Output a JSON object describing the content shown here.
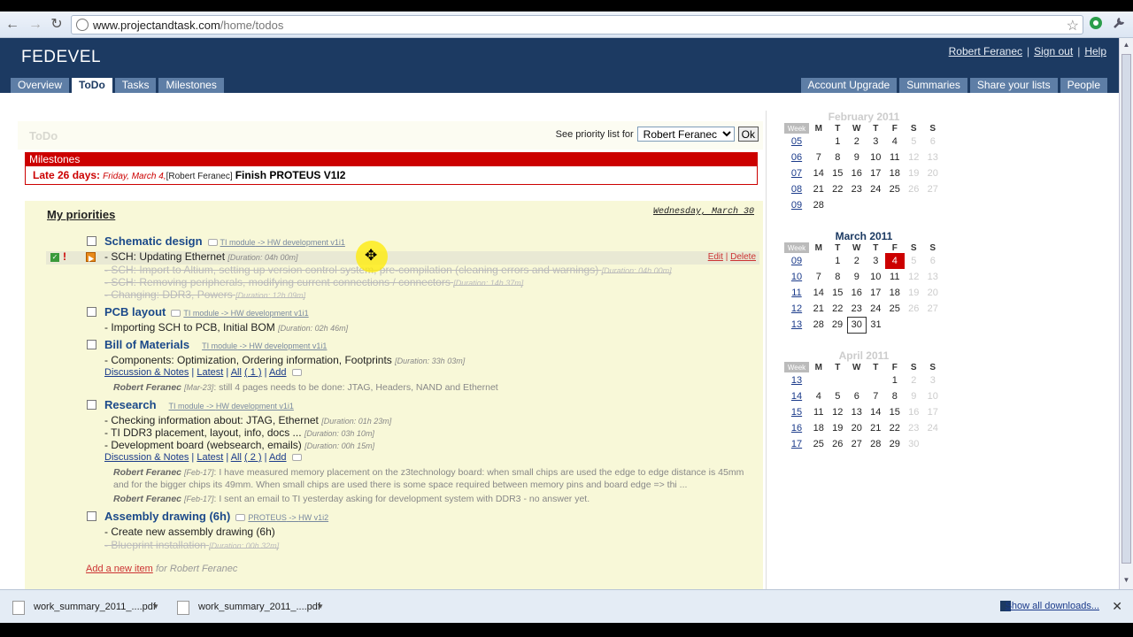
{
  "browser": {
    "url_host": "www.projectandtask.com",
    "url_path": "/home/todos",
    "back_icon": "←",
    "forward_icon": "→",
    "reload_icon": "↻",
    "star_icon": "☆"
  },
  "header": {
    "logo": "FEDEVEL",
    "user": "Robert Feranec",
    "signout": "Sign out",
    "help": "Help",
    "sep": "|",
    "tabs_left": [
      "Overview",
      "ToDo",
      "Tasks",
      "Milestones"
    ],
    "tabs_right": [
      "Account Upgrade",
      "Summaries",
      "Share your lists",
      "People"
    ]
  },
  "todo": {
    "title": "ToDo",
    "priority_label": "See priority list for",
    "priority_selected": "Robert Feranec",
    "ok": "Ok"
  },
  "milestones": {
    "heading": "Milestones",
    "late": "Late 26 days:",
    "date": "Friday, March 4,",
    "who": "[Robert Feranec]",
    "name": "Finish PROTEUS V1I2"
  },
  "priorities": {
    "heading": "My priorities",
    "date": "Wednesday, March 30",
    "edit": "Edit",
    "delete": "Delete",
    "add_new": "Add a new item",
    "add_for": "for Robert Feranec",
    "items": [
      {
        "title": "Schematic design",
        "c1": "TI module",
        "c2": "HW development v1i1",
        "tasks": [
          {
            "t": "- SCH: Updating Ethernet",
            "d": "[Duration: 04h 00m]"
          },
          {
            "t": "- SCH: Import to Altium, setting up version control system, pre-compilation (cleaning errors and warnings)",
            "d": "[Duration: 04h 00m]"
          },
          {
            "t": "- SCH: Removing peripherals, modifying current connections / connectors",
            "d": "[Duration: 14h 37m]"
          },
          {
            "t": "- Changing: DDR3, Powers",
            "d": "[Duration: 12h 09m]"
          }
        ]
      },
      {
        "title": "PCB layout",
        "c1": "TI module",
        "c2": "HW development v1i1",
        "tasks": [
          {
            "t": "- Importing SCH to PCB, Initial BOM",
            "d": "[Duration: 02h 46m]"
          }
        ]
      },
      {
        "title": "Bill of Materials",
        "c1": "TI module",
        "c2": "HW development v1i1",
        "tasks": [
          {
            "t": "- Components: Optimization, Ordering information, Footprints",
            "d": "[Duration: 33h 03m]"
          }
        ],
        "notes": {
          "label": "Discussion & Notes",
          "latest": "Latest",
          "all": "All",
          "count": "( 1 )",
          "add": "Add"
        },
        "comments": [
          {
            "who": "Robert Feranec",
            "when": "[Mar-23]",
            "text": ": still 4 pages needs to be done: JTAG, Headers, NAND and Ethernet"
          }
        ]
      },
      {
        "title": "Research",
        "c1": "TI module",
        "c2": "HW development v1i1",
        "tasks": [
          {
            "t": "- Checking information about: JTAG, Ethernet",
            "d": "[Duration: 01h 23m]"
          },
          {
            "t": "- TI DDR3 placement, layout, info, docs ...",
            "d": "[Duration: 03h 10m]"
          },
          {
            "t": "- Development board (websearch, emails)",
            "d": "[Duration: 00h 15m]"
          }
        ],
        "notes": {
          "label": "Discussion & Notes",
          "latest": "Latest",
          "all": "All",
          "count": "( 2 )",
          "add": "Add"
        },
        "comments": [
          {
            "who": "Robert Feranec",
            "when": "[Feb-17]",
            "text": ": I have measured memory placement on the z3technology board: when small chips are used the edge to edge distance is 45mm and for the bigger chips its 49mm. When small chips are used there is some space required between memory pins and board edge => thi ..."
          },
          {
            "who": "Robert Feranec",
            "when": "[Feb-17]",
            "text": ": I sent an email to TI yesterday asking for development system with DDR3 - no answer yet."
          }
        ]
      },
      {
        "title": "Assembly drawing (6h)",
        "c1": "PROTEUS",
        "c2": "HW v1i2",
        "tasks": [
          {
            "t": "- Create new assembly drawing (6h)",
            "d": ""
          },
          {
            "t": "- Blueprint installation",
            "d": "[Duration: 00h 32m]"
          }
        ]
      }
    ]
  },
  "calendars": [
    {
      "title": "February 2011",
      "faded": true,
      "head": [
        "Week",
        "M",
        "T",
        "W",
        "T",
        "F",
        "S",
        "S"
      ],
      "rows": [
        [
          "05",
          "",
          "1",
          "2",
          "3",
          "4",
          "5",
          "6"
        ],
        [
          "06",
          "7",
          "8",
          "9",
          "10",
          "11",
          "12",
          "13"
        ],
        [
          "07",
          "14",
          "15",
          "16",
          "17",
          "18",
          "19",
          "20"
        ],
        [
          "08",
          "21",
          "22",
          "23",
          "24",
          "25",
          "26",
          "27"
        ],
        [
          "09",
          "28",
          "",
          "",
          "",
          "",
          "",
          ""
        ]
      ]
    },
    {
      "title": "March 2011",
      "faded": false,
      "head": [
        "Week",
        "M",
        "T",
        "W",
        "T",
        "F",
        "S",
        "S"
      ],
      "today": "4",
      "selected": "30",
      "rows": [
        [
          "09",
          "",
          "1",
          "2",
          "3",
          "4",
          "5",
          "6"
        ],
        [
          "10",
          "7",
          "8",
          "9",
          "10",
          "11",
          "12",
          "13"
        ],
        [
          "11",
          "14",
          "15",
          "16",
          "17",
          "18",
          "19",
          "20"
        ],
        [
          "12",
          "21",
          "22",
          "23",
          "24",
          "25",
          "26",
          "27"
        ],
        [
          "13",
          "28",
          "29",
          "30",
          "31",
          "",
          "",
          ""
        ]
      ]
    },
    {
      "title": "April 2011",
      "faded": true,
      "head": [
        "Week",
        "M",
        "T",
        "W",
        "T",
        "F",
        "S",
        "S"
      ],
      "rows": [
        [
          "13",
          "",
          "",
          "",
          "",
          "1",
          "2",
          "3"
        ],
        [
          "14",
          "4",
          "5",
          "6",
          "7",
          "8",
          "9",
          "10"
        ],
        [
          "15",
          "11",
          "12",
          "13",
          "14",
          "15",
          "16",
          "17"
        ],
        [
          "16",
          "18",
          "19",
          "20",
          "21",
          "22",
          "23",
          "24"
        ],
        [
          "17",
          "25",
          "26",
          "27",
          "28",
          "29",
          "30",
          ""
        ]
      ]
    }
  ],
  "downloads": {
    "files": [
      "work_summary_2011_....pdf",
      "work_summary_2011_....pdf"
    ],
    "show_all": "Show all downloads...",
    "close": "✕"
  }
}
